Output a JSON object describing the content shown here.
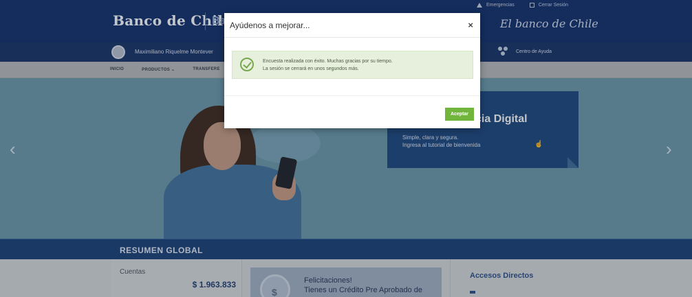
{
  "header": {
    "logo": "Banco de Chile",
    "logo_sub": "Ba",
    "emergencies": "Emergencias",
    "logout": "Cerrar Sesión",
    "script_logo": "El banco de Chile"
  },
  "userbar": {
    "user_name": "Maximiliano Riquelme Montever",
    "help": "Centro de Ayuda"
  },
  "nav": {
    "items": [
      "INICIO",
      "PRODUCTOS ⌄",
      "TRANSFERE"
    ]
  },
  "hero": {
    "promo_title": "cia Digital",
    "promo_line1": "Simple, clara y segura.",
    "promo_line2": "Ingresa al tutorial de bienvenida",
    "prev_arrow": "‹",
    "next_arrow": "›"
  },
  "summary": {
    "title": "RESUMEN GLOBAL",
    "accounts_label": "Cuentas",
    "balance": "$ 1.963.833",
    "promo_line1": "Felicitaciones!",
    "promo_line2": "Tienes un Crédito Pre Aprobado de",
    "shortcuts": "Accesos Directos"
  },
  "modal": {
    "title": "Ayúdenos a mejorar...",
    "close": "×",
    "message_line1": "Encuesta realizada con éxito. Muchas gracias por su tiempo.",
    "message_line2": "La sesión se cerrará en unos segundos más.",
    "ok_label": "Aceptar"
  },
  "colors": {
    "brand_navy": "#0d2c68",
    "accept_green": "#72b53c",
    "success_bg": "#e6f0dc"
  },
  "icons": [
    "warning-icon",
    "logout-icon",
    "user-avatar-icon",
    "help-center-icon",
    "check-circle-icon",
    "close-icon",
    "chevron-left-icon",
    "chevron-right-icon"
  ]
}
